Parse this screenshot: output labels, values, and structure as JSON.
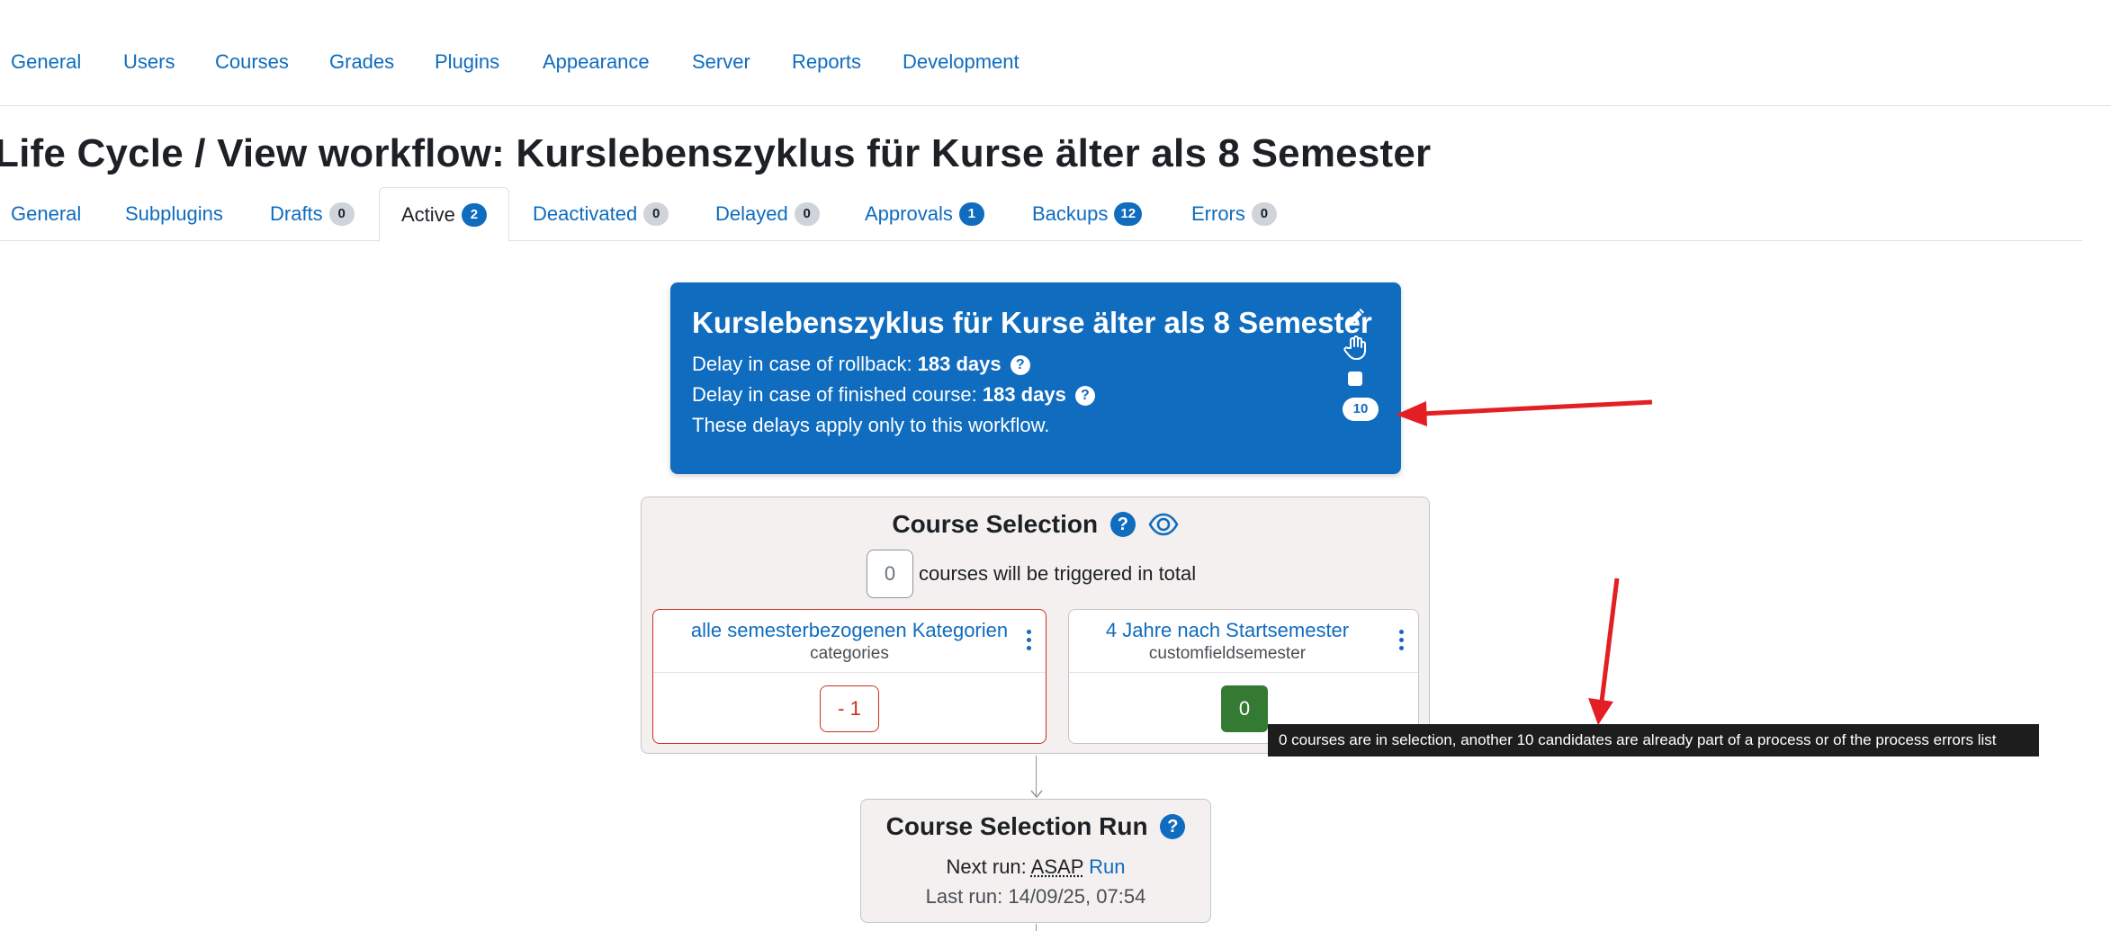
{
  "nav": {
    "items": [
      "General",
      "Users",
      "Courses",
      "Grades",
      "Plugins",
      "Appearance",
      "Server",
      "Reports",
      "Development"
    ]
  },
  "page": {
    "title": "Life Cycle / View workflow: Kurslebenszyklus für Kurse älter als 8 Semester"
  },
  "tabs": [
    {
      "label": "General"
    },
    {
      "label": "Subplugins"
    },
    {
      "label": "Drafts",
      "badge": "0"
    },
    {
      "label": "Active",
      "badge": "2"
    },
    {
      "label": "Deactivated",
      "badge": "0"
    },
    {
      "label": "Delayed",
      "badge": "0"
    },
    {
      "label": "Approvals",
      "badge": "1"
    },
    {
      "label": "Backups",
      "badge": "12"
    },
    {
      "label": "Errors",
      "badge": "0"
    }
  ],
  "workflow": {
    "title": "Kurslebenszyklus für Kurse älter als 8 Semester",
    "rollback_label": "Delay in case of rollback: ",
    "rollback_value": "183 days",
    "finished_label": "Delay in case of finished course: ",
    "finished_value": "183 days",
    "note": "These delays apply only to this workflow.",
    "count": "10",
    "help_glyph": "?",
    "icons": [
      "pencil-icon",
      "hand-icon",
      "stop-icon"
    ]
  },
  "selection": {
    "title": "Course Selection",
    "help_glyph": "?",
    "total": "0",
    "total_text": "courses will be triggered in total",
    "triggers": [
      {
        "name": "alle semesterbezogenen Kategorien",
        "type": "categories",
        "value": "- 1"
      },
      {
        "name": "4 Jahre nach Startsemester",
        "type": "customfieldsemester",
        "value": "0"
      }
    ],
    "tooltip": "0 courses are in selection, another 10 candidates are already part of a process or of the process errors list"
  },
  "run": {
    "title": "Course Selection Run",
    "help_glyph": "?",
    "next_label": "Next run: ",
    "next_value": "ASAP",
    "run_link": "Run",
    "last_label": "Last run: 14/09/25, 07:54"
  },
  "colors": {
    "primary": "#0f6cbf",
    "danger": "#ca3120",
    "success": "#357a32",
    "annotation": "#e31e24"
  }
}
